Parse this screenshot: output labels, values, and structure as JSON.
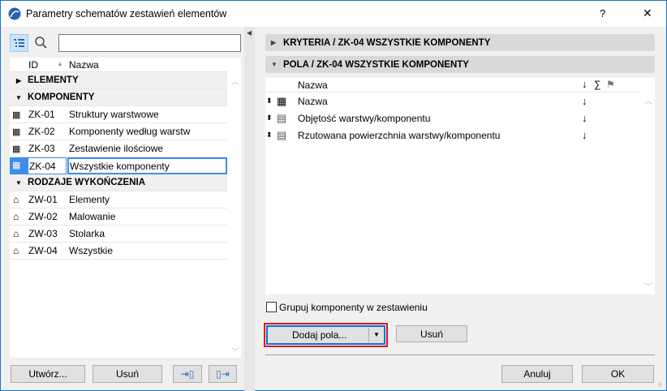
{
  "window": {
    "title": "Parametry schematów zestawień elementów",
    "help": "?",
    "close": "✕"
  },
  "left": {
    "search_placeholder": "",
    "columns": {
      "id": "ID",
      "name": "Nazwa"
    },
    "groups": [
      {
        "label": "ELEMENTY",
        "expanded": false,
        "items": []
      },
      {
        "label": "KOMPONENTY",
        "expanded": true,
        "items": [
          {
            "id": "ZK-01",
            "name": "Struktury warstwowe"
          },
          {
            "id": "ZK-02",
            "name": "Komponenty według warstw"
          },
          {
            "id": "ZK-03",
            "name": "Zestawienie ilościowe"
          },
          {
            "id": "ZK-04",
            "name": "Wszystkie komponenty",
            "selected": true
          }
        ]
      },
      {
        "label": "RODZAJE WYKOŃCZENIA",
        "expanded": true,
        "items": [
          {
            "id": "ZW-01",
            "name": "Elementy"
          },
          {
            "id": "ZW-02",
            "name": "Malowanie"
          },
          {
            "id": "ZW-03",
            "name": "Stolarka"
          },
          {
            "id": "ZW-04",
            "name": "Wszystkie"
          }
        ]
      }
    ],
    "buttons": {
      "create": "Utwórz...",
      "delete": "Usuń"
    }
  },
  "right": {
    "criteria_header": "KRYTERIA / ZK-04 WSZYSTKIE KOMPONENTY",
    "fields_header": "POLA / ZK-04 WSZYSTKIE KOMPONENTY",
    "fields_columns": {
      "name": "Nazwa",
      "sort": "↓",
      "sum": "∑"
    },
    "fields": [
      {
        "name": "Nazwa",
        "sort": "↓",
        "icon": "brick-icon"
      },
      {
        "name": "Objętość warstwy/komponentu",
        "sort": "↓",
        "icon": "hatch-icon"
      },
      {
        "name": "Rzutowana powierzchnia warstwy/komponentu",
        "sort": "↓",
        "icon": "hatch-icon"
      }
    ],
    "group_checkbox": {
      "label": "Grupuj komponenty w zestawieniu",
      "checked": false
    },
    "add_fields": "Dodaj pola...",
    "remove": "Usuń",
    "cancel": "Anuluj",
    "ok": "OK"
  },
  "colors": {
    "accent": "#0078d7",
    "highlight": "#e81123"
  }
}
